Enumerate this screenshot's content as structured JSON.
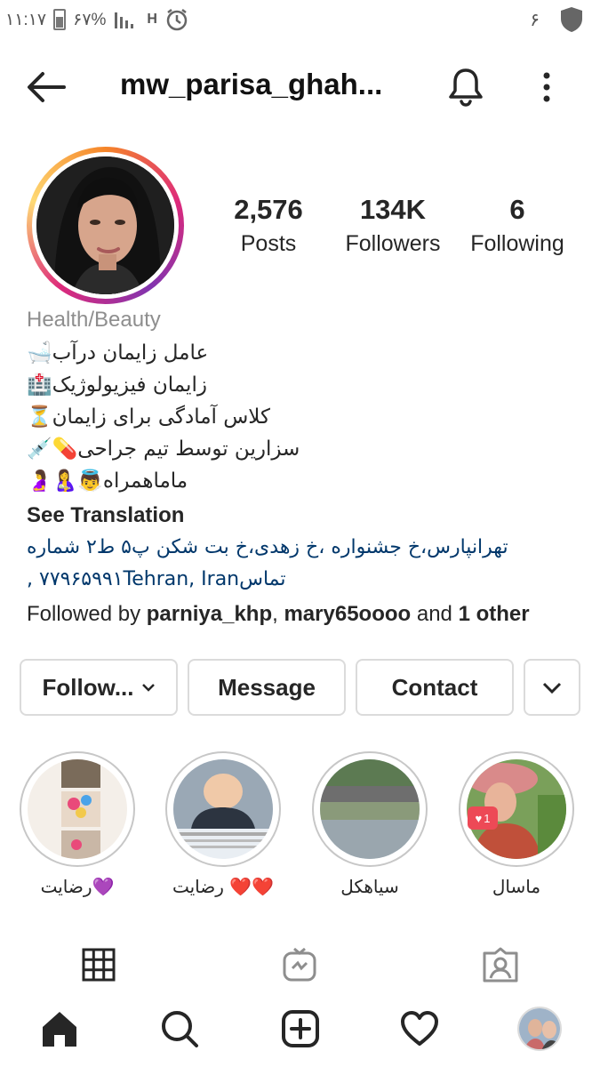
{
  "status_bar": {
    "time": "۱۱:۱۷",
    "battery": "۶۷%",
    "network": "H",
    "notification_count": "۶"
  },
  "header": {
    "username": "mw_parisa_ghah..."
  },
  "profile": {
    "stats": [
      {
        "value": "2,576",
        "label": "Posts"
      },
      {
        "value": "134K",
        "label": "Followers"
      },
      {
        "value": "6",
        "label": "Following"
      }
    ],
    "category": "Health/Beauty",
    "bio_lines": [
      "عامل زایمان درآب🛁",
      "زایمان فیزیولوژیک🏥",
      "کلاس آمادگی برای زایمان⏳",
      "سزارین توسط تیم جراحی💊💉",
      "ماماهمراه👼🤱🤰"
    ],
    "see_translation": "See Translation",
    "address_line1": "تهرانپارس،خ جشنواره ،خ زهدی،خ بت شکن پ۵ ط۲ شماره",
    "address_line2": "تماس۷۷۹۶۵۹۹۱Tehran, Iran ,",
    "followed_by": {
      "prefix": "Followed by ",
      "user1": "parniya_khp",
      "sep": ", ",
      "user2": "mary65oooo",
      "and": " and ",
      "other": "1 other"
    }
  },
  "actions": {
    "follow": "Follow...",
    "message": "Message",
    "contact": "Contact"
  },
  "highlights": [
    {
      "label": "رضایت💜"
    },
    {
      "label": "رضایت ❤️❤️"
    },
    {
      "label": "سیاهکل"
    },
    {
      "label": "ماسال",
      "badge": "1"
    }
  ],
  "colors": {
    "link": "#00376b",
    "border": "#dbdbdb",
    "muted": "#8e8e8e",
    "text": "#262626"
  }
}
